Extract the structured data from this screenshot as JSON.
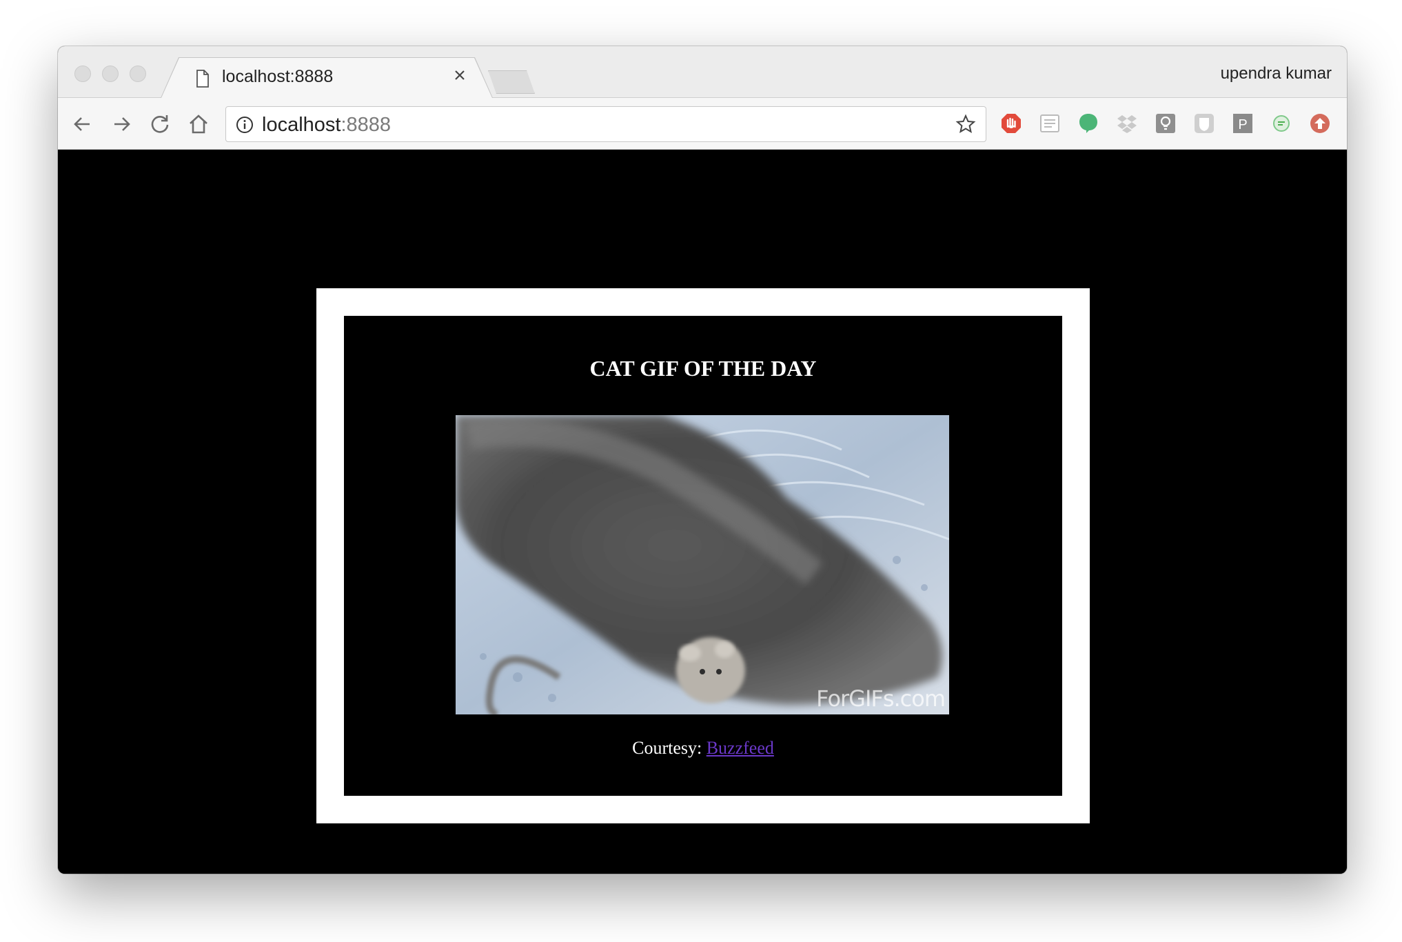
{
  "browser": {
    "tab": {
      "title": "localhost:8888",
      "close_glyph": "×",
      "icon": "page-icon"
    },
    "profile_name": "upendra kumar",
    "toolbar": {
      "back_icon": "back-arrow-icon",
      "forward_icon": "forward-arrow-icon",
      "reload_icon": "reload-icon",
      "home_icon": "home-icon"
    },
    "omnibox": {
      "host": "localhost",
      "port": ":8888",
      "info_icon": "info-icon",
      "bookmark_icon": "star-icon"
    },
    "extensions": [
      "adblock-icon",
      "reader-icon",
      "green-bubble-icon",
      "dropbox-icon",
      "lightbulb-icon",
      "shield-icon",
      "p-icon",
      "chat-icon",
      "upload-icon"
    ]
  },
  "page": {
    "heading": "CAT GIF OF THE DAY",
    "image": {
      "watermark": "ForGIFs.com"
    },
    "courtesy_label": "Courtesy:",
    "courtesy_link": "Buzzfeed"
  }
}
